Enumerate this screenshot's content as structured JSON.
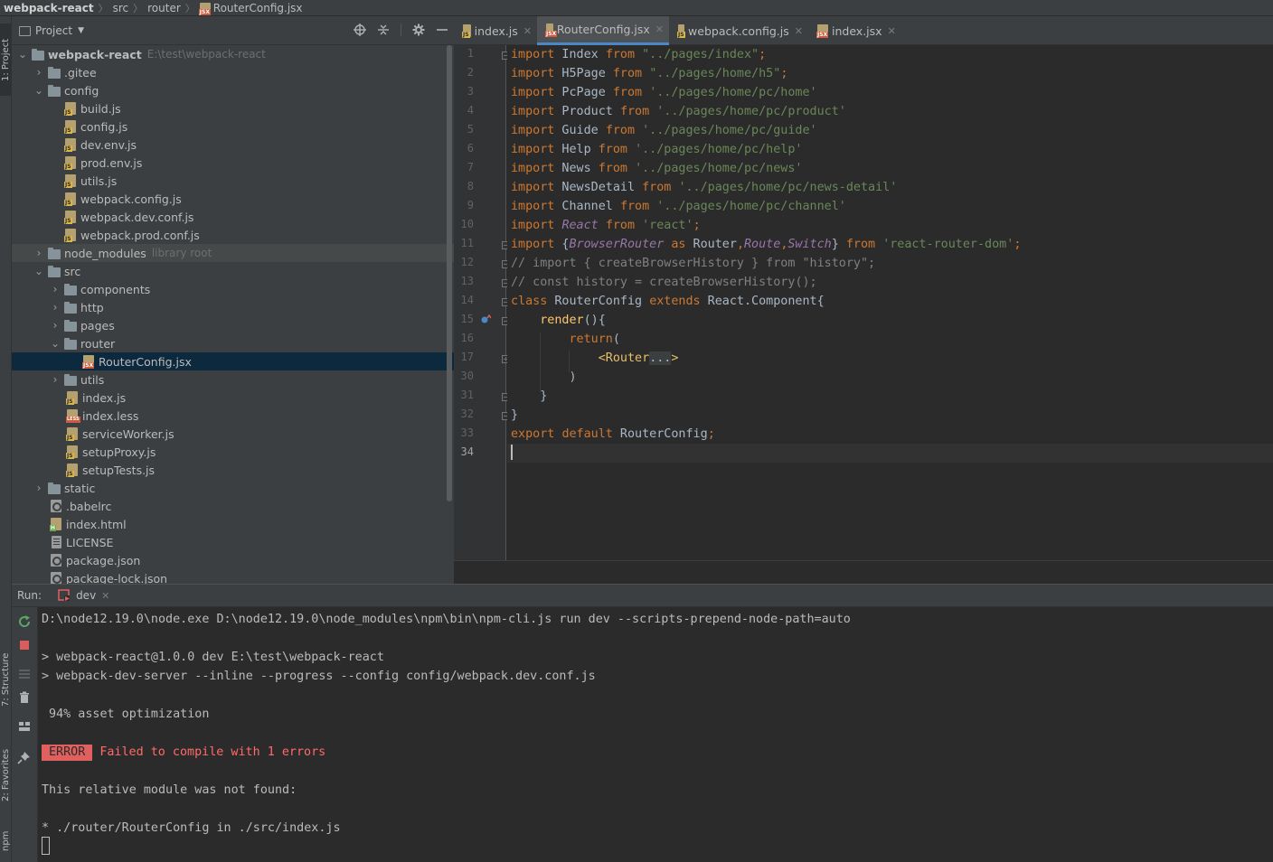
{
  "breadcrumb": {
    "items": [
      "webpack-react",
      "src",
      "router",
      "RouterConfig.jsx"
    ]
  },
  "side_tabs": {
    "project": "1: Project",
    "structure": "7: Structure",
    "favorites": "2: Favorites",
    "npm": "npm"
  },
  "project_panel": {
    "title": "Project",
    "tree": [
      {
        "name": "webpack-react",
        "hint": "E:\\test\\webpack-react"
      },
      {
        "name": ".gitee"
      },
      {
        "name": "config"
      },
      {
        "name": "build.js"
      },
      {
        "name": "config.js"
      },
      {
        "name": "dev.env.js"
      },
      {
        "name": "prod.env.js"
      },
      {
        "name": "utils.js"
      },
      {
        "name": "webpack.config.js"
      },
      {
        "name": "webpack.dev.conf.js"
      },
      {
        "name": "webpack.prod.conf.js"
      },
      {
        "name": "node_modules",
        "hint": "library root"
      },
      {
        "name": "src"
      },
      {
        "name": "components"
      },
      {
        "name": "http"
      },
      {
        "name": "pages"
      },
      {
        "name": "router"
      },
      {
        "name": "RouterConfig.jsx"
      },
      {
        "name": "utils"
      },
      {
        "name": "index.js"
      },
      {
        "name": "index.less"
      },
      {
        "name": "serviceWorker.js"
      },
      {
        "name": "setupProxy.js"
      },
      {
        "name": "setupTests.js"
      },
      {
        "name": "static"
      },
      {
        "name": ".babelrc"
      },
      {
        "name": "index.html"
      },
      {
        "name": "LICENSE"
      },
      {
        "name": "package.json"
      },
      {
        "name": "package-lock.json"
      }
    ]
  },
  "editor_tabs": [
    {
      "label": "index.js"
    },
    {
      "label": "RouterConfig.jsx"
    },
    {
      "label": "webpack.config.js"
    },
    {
      "label": "index.jsx"
    }
  ],
  "editor": {
    "line_numbers": [
      "1",
      "2",
      "3",
      "4",
      "5",
      "6",
      "7",
      "8",
      "9",
      "10",
      "11",
      "12",
      "13",
      "14",
      "15",
      "16",
      "17",
      "30",
      "31",
      "32",
      "33",
      "34"
    ],
    "code": {
      "l1": {
        "a": "import",
        "b": " Index ",
        "c": "from",
        "d": " ",
        "e": "\"../pages/index\"",
        "f": ";"
      },
      "l2": {
        "a": "import",
        "b": " H5Page ",
        "c": "from",
        "d": " ",
        "e": "\"../pages/home/h5\"",
        "f": ";"
      },
      "l3": {
        "a": "import",
        "b": " PcPage ",
        "c": "from",
        "d": " ",
        "e": "'../pages/home/pc/home'"
      },
      "l4": {
        "a": "import",
        "b": " Product ",
        "c": "from",
        "d": " ",
        "e": "'../pages/home/pc/product'"
      },
      "l5": {
        "a": "import",
        "b": " Guide ",
        "c": "from",
        "d": " ",
        "e": "'../pages/home/pc/guide'"
      },
      "l6": {
        "a": "import",
        "b": " Help ",
        "c": "from",
        "d": " ",
        "e": "'../pages/home/pc/help'"
      },
      "l7": {
        "a": "import",
        "b": " News ",
        "c": "from",
        "d": " ",
        "e": "'../pages/home/pc/news'"
      },
      "l8": {
        "a": "import",
        "b": " NewsDetail ",
        "c": "from",
        "d": " ",
        "e": "'../pages/home/pc/news-detail'"
      },
      "l9": {
        "a": "import",
        "b": " Channel ",
        "c": "from",
        "d": " ",
        "e": "'../pages/home/pc/channel'"
      },
      "l10": {
        "a": "import",
        "b": " ",
        "c": "React",
        "d": " ",
        "e": "from",
        "f": " ",
        "g": "'react'",
        "h": ";"
      },
      "l11": {
        "a": "import",
        "b": " {",
        "c": "BrowserRouter",
        "d": " ",
        "e": "as",
        "f": " Router",
        "g": ",",
        "h": "Route",
        "i": ",",
        "j": "Switch",
        "k": "} ",
        "l": "from",
        "m": " ",
        "n": "'react-router-dom'",
        "o": ";"
      },
      "l12": "// import { createBrowserHistory } from \"history\";",
      "l13": "// const history = createBrowserHistory();",
      "l14": {
        "a": "class",
        "b": " RouterConfig ",
        "c": "extends",
        "d": " React.Component{"
      },
      "l15": {
        "a": "    ",
        "b": "render",
        "c": "(){"
      },
      "l16": {
        "a": "        ",
        "b": "return",
        "c": "("
      },
      "l17": {
        "a": "            ",
        "b": "<Router",
        "c": "...",
        "d": ">"
      },
      "l30": "        )",
      "l31": "    }",
      "l32": "}",
      "l33": {
        "a": "export",
        "b": " ",
        "c": "default",
        "d": " RouterConfig",
        "e": ";"
      },
      "l34": ""
    }
  },
  "run_panel": {
    "label": "Run:",
    "tab": "dev"
  },
  "console": {
    "line1": "D:\\node12.19.0\\node.exe D:\\node12.19.0\\node_modules\\npm\\bin\\npm-cli.js run dev --scripts-prepend-node-path=auto",
    "line2": "> webpack-react@1.0.0 dev E:\\test\\webpack-react",
    "line3": "> webpack-dev-server --inline --progress --config config/webpack.dev.conf.js",
    "line4": " 94% asset optimization",
    "error_badge": "ERROR",
    "error_text": "Failed to compile with 1 errors",
    "line6": "This relative module was not found:",
    "line7": "* ./router/RouterConfig in ./src/index.js"
  },
  "colors": {
    "background": "#2b2b2b",
    "panel": "#3c3f41",
    "keyword": "#cc7832",
    "string": "#6a8759",
    "comment": "#808080",
    "function": "#ffc66d",
    "field": "#9876aa",
    "error": "#ff6b68",
    "selection": "#0d293e",
    "tab_underline": "#4a88c7"
  }
}
